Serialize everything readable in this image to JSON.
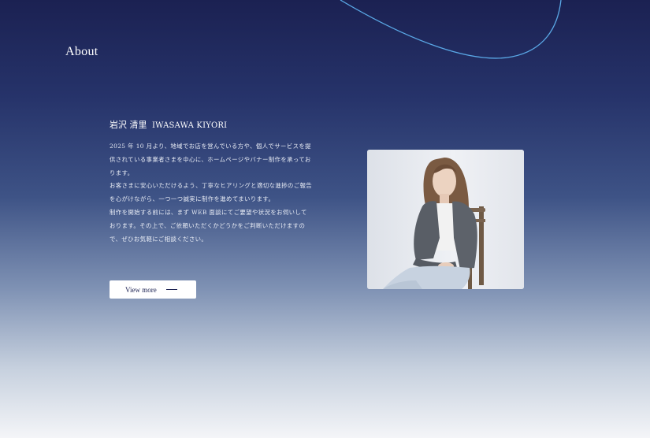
{
  "about": {
    "title": "About",
    "name_ja": "岩沢 清里",
    "name_en": "IWASAWA KIYORI",
    "bio": [
      "2025 年 10 月より、地域でお店を営んでいる方や、個人でサービスを提供されている事業者さまを中心に、ホームページやバナー制作を承っております。",
      "お客さまに安心いただけるよう、丁寧なヒアリングと適切な進捗のご報告を心がけながら、一つ一つ誠実に制作を進めてまいります。",
      "制作を開始する前には、まず WEB 面談にてご要望や状況をお伺いしております。その上で、ご依頼いただくかどうかをご判断いただけますので、ぜひお気軽にご相談ください。"
    ],
    "view_more_label": "View more"
  },
  "colors": {
    "background_top": "#1b2152",
    "background_bottom": "#f4f5f8",
    "accent_curve": "#5aa8e6"
  }
}
